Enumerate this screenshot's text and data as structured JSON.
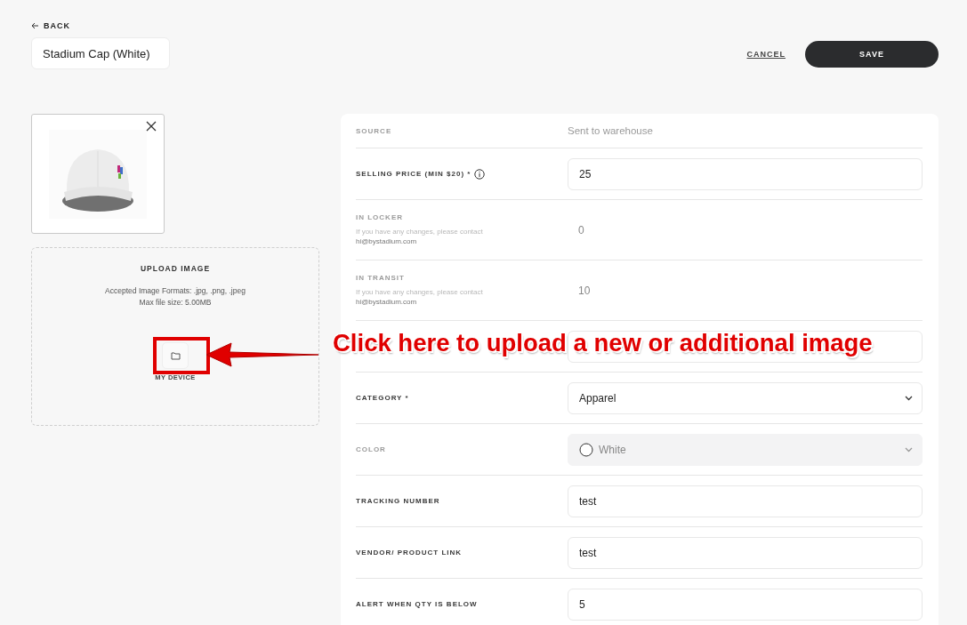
{
  "header": {
    "back": "BACK",
    "title": "Stadium Cap (White)",
    "cancel": "CANCEL",
    "save": "SAVE"
  },
  "upload": {
    "title": "UPLOAD IMAGE",
    "formats": "Accepted Image Formats: .jpg, .png, .jpeg",
    "max_size": "Max file size: 5.00MB",
    "device_label": "MY DEVICE"
  },
  "annotation": {
    "text": "Click here to upload a new or additional image"
  },
  "rows": [
    {
      "kind": "static",
      "label": "SOURCE",
      "muted": true,
      "value": "Sent to warehouse"
    },
    {
      "kind": "input",
      "label": "SELLING PRICE (MIN $20) *",
      "muted": false,
      "info_icon": true,
      "value": "25"
    },
    {
      "kind": "readonly",
      "label": "IN LOCKER",
      "muted": true,
      "hint": "If you have any changes, please contact",
      "email": "hi@bystadium.com",
      "value": "0"
    },
    {
      "kind": "readonly",
      "label": "IN TRANSIT",
      "muted": true,
      "hint": "If you have any changes, please contact",
      "email": "hi@bystadium.com",
      "value": "10"
    },
    {
      "kind": "input"
    },
    {
      "kind": "select",
      "label": "CATEGORY *",
      "muted": false,
      "disabled": false,
      "value": "Apparel"
    },
    {
      "kind": "select",
      "label": "COLOR",
      "muted": true,
      "disabled": true,
      "swatch": true,
      "value": "White"
    },
    {
      "kind": "input",
      "label": "TRACKING NUMBER",
      "muted": false,
      "value": "test"
    },
    {
      "kind": "input",
      "label": "VENDOR/ PRODUCT LINK",
      "muted": false,
      "value": "test"
    },
    {
      "kind": "input",
      "label": "ALERT WHEN QTY IS BELOW",
      "muted": false,
      "value": "5"
    }
  ]
}
